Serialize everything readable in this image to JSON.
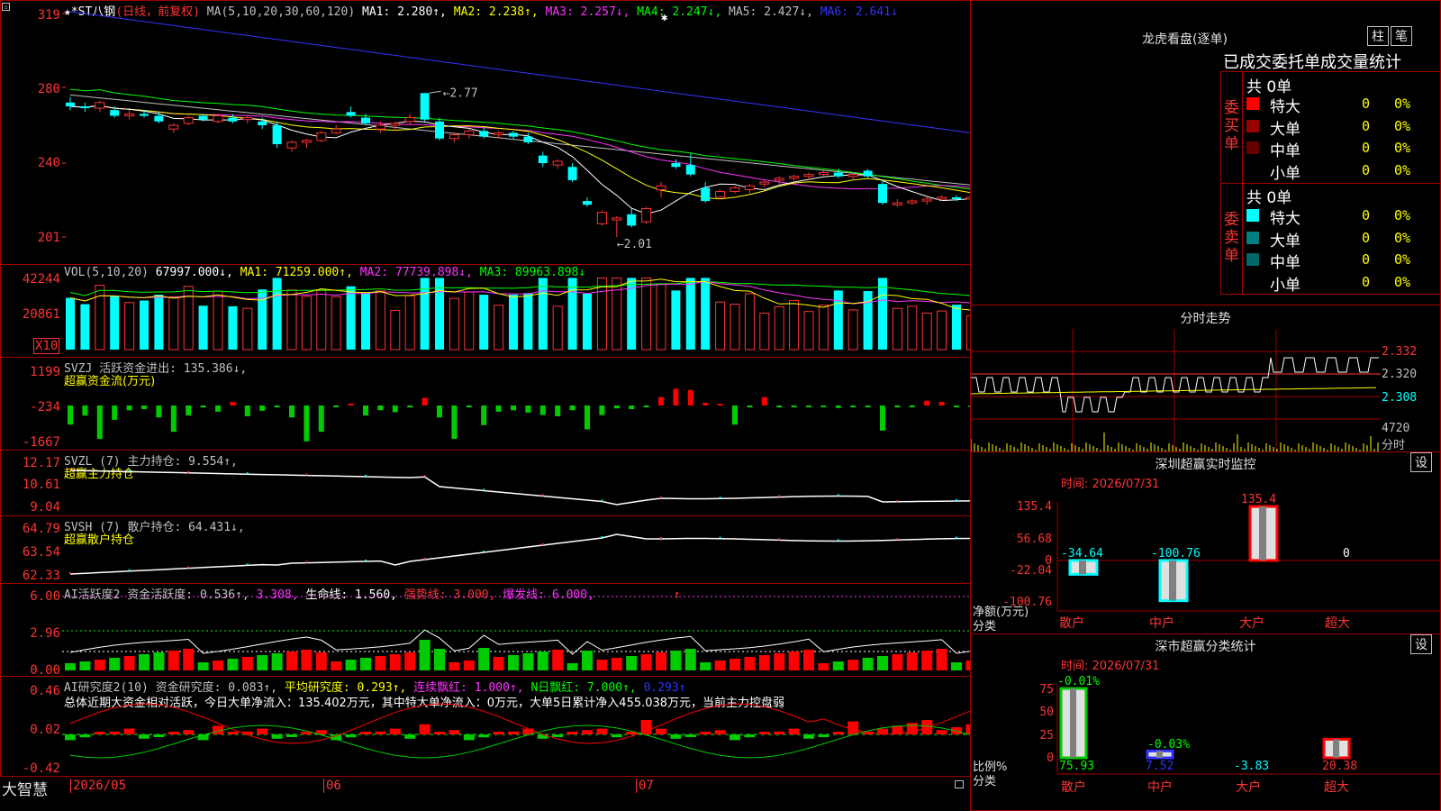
{
  "main": {
    "header": {
      "stock": "★*ST八钢",
      "mode": "(日线，前复权)",
      "ma_text": "MA(5,10,20,30,60,120)",
      "ma1": "MA1: 2.280↑,",
      "ma2": "MA2: 2.238↑,",
      "ma3": "MA3: 2.257↓,",
      "ma4": "MA4: 2.247↓,",
      "ma5": "MA5: 2.427↓,",
      "ma6": "MA6: 2.641↓"
    },
    "y_ticks": [
      "319",
      "280",
      "240",
      "201"
    ],
    "annot_high": "2.77",
    "annot_low": "2.01"
  },
  "vol": {
    "header": {
      "name": "VOL(5,10,20)",
      "v": "67997.000↓,",
      "ma1": "MA1: 71259.000↑,",
      "ma2": "MA2: 77739.898↓,",
      "ma3": "MA3: 89963.898↓"
    },
    "y_ticks": [
      "42244",
      "20861"
    ],
    "unit": "X10"
  },
  "svzj": {
    "header": {
      "name": "SVZJ  活跃资金进出: 135.386↓,",
      "sub": "超赢资金流(万元)"
    },
    "y_ticks": [
      "1199",
      "-234",
      "-1667"
    ]
  },
  "svzl": {
    "header": {
      "name": "SVZL (7) 主力持仓: 9.554↑,",
      "sub": "超赢主力持仓"
    },
    "y_ticks": [
      "12.17",
      "10.61",
      "9.04"
    ]
  },
  "svsh": {
    "header": {
      "name": "SVSH (7) 散户持仓: 64.431↓,",
      "sub": "超赢散户持仓"
    },
    "y_ticks": [
      "64.79",
      "63.54",
      "62.33"
    ]
  },
  "ai1": {
    "header": {
      "name": "AI活跃度2 资金活跃度: 0.536↑,",
      "v2": "3.308,",
      "life": "生命线: 1.560,",
      "strong": "强势线: 3.000,",
      "burst": "爆发线: 6.000,",
      "arrow": "↑"
    },
    "y_ticks": [
      "6.00",
      "2.96",
      "0.00"
    ]
  },
  "ai2": {
    "header": {
      "name": "AI研究度2(10) 资金研究度: 0.083↑,",
      "avg": "平均研究度: 0.293↑,",
      "cont": "连续飘红: 1.000↑,",
      "nday": "N日飘红: 7.000↑,",
      "last": "0.293↑"
    },
    "summary": "总体近期大资金相对活跃，今日大单净流入：135.402万元，其中特大单净流入：0万元，大单5日累计净入455.038万元，当前主力控盘弱",
    "y_ticks": [
      "0.46",
      "0.02",
      "-0.42"
    ]
  },
  "bottom": {
    "brand": "大智慧",
    "dates": [
      "2026/05",
      "06",
      "07"
    ]
  },
  "longhu": {
    "title": "龙虎看盘(逐单)",
    "btn_zhu": "柱",
    "btn_bi": "笔",
    "subtitle": "已成交委托单成交量统计",
    "buy_label": "委买单",
    "sell_label": "委卖单",
    "buy_total": "共 0单",
    "sell_total": "共 0单",
    "buy_rows": [
      {
        "label": "特大",
        "count": "0",
        "pct": "0%",
        "color": "#ff0000"
      },
      {
        "label": "大单",
        "count": "0",
        "pct": "0%",
        "color": "#990000"
      },
      {
        "label": "中单",
        "count": "0",
        "pct": "0%",
        "color": "#660000"
      },
      {
        "label": "小单",
        "count": "0",
        "pct": "0%",
        "color": "#000000"
      }
    ],
    "sell_rows": [
      {
        "label": "特大",
        "count": "0",
        "pct": "0%",
        "color": "#00ffff"
      },
      {
        "label": "大单",
        "count": "0",
        "pct": "0%",
        "color": "#008080"
      },
      {
        "label": "中单",
        "count": "0",
        "pct": "0%",
        "color": "#006666"
      },
      {
        "label": "小单",
        "count": "0",
        "pct": "0%",
        "color": "#000000"
      }
    ]
  },
  "fenshi": {
    "title": "分时走势",
    "y_ticks": [
      "2.332",
      "2.320",
      "2.308"
    ],
    "vol_tick": "4720",
    "vol_unit": "分时"
  },
  "sz_monitor": {
    "title": "深圳超赢实时监控",
    "btn": "设",
    "time": "时间: 2026/07/31",
    "y_ticks": [
      "135.4",
      "56.68",
      "0",
      "-22.04",
      "-100.76"
    ],
    "ylabel1": "净额(万元)",
    "ylabel2": "分类",
    "categories": [
      "散户",
      "中户",
      "大户",
      "超大"
    ],
    "values": [
      "-34.64",
      "-100.76",
      "135.4",
      "0"
    ]
  },
  "sz_stats": {
    "title": "深市超赢分类统计",
    "btn": "设",
    "time": "时间: 2026/07/31",
    "y_ticks": [
      "75",
      "50",
      "25",
      "0"
    ],
    "ylabel1": "比例%",
    "ylabel2": "分类",
    "categories": [
      "散户",
      "中户",
      "大户",
      "超大"
    ],
    "top_labels": [
      "-0.01%",
      "-0.03%"
    ],
    "values": [
      "75.93",
      "7.52",
      "-3.83",
      "20.38"
    ]
  },
  "chart_data": {
    "type": "line",
    "title": "",
    "candles": [
      [
        2.72,
        2.75,
        2.68,
        2.7
      ],
      [
        2.7,
        2.72,
        2.67,
        2.69
      ],
      [
        2.69,
        2.73,
        2.67,
        2.72
      ],
      [
        2.68,
        2.7,
        2.64,
        2.65
      ],
      [
        2.65,
        2.68,
        2.63,
        2.66
      ],
      [
        2.66,
        2.68,
        2.64,
        2.65
      ],
      [
        2.65,
        2.67,
        2.61,
        2.62
      ],
      [
        2.58,
        2.61,
        2.56,
        2.6
      ],
      [
        2.61,
        2.65,
        2.6,
        2.64
      ],
      [
        2.65,
        2.66,
        2.62,
        2.63
      ],
      [
        2.62,
        2.66,
        2.61,
        2.65
      ],
      [
        2.64,
        2.66,
        2.61,
        2.62
      ],
      [
        2.63,
        2.65,
        2.61,
        2.64
      ],
      [
        2.62,
        2.64,
        2.58,
        2.6
      ],
      [
        2.6,
        2.62,
        2.48,
        2.5
      ],
      [
        2.48,
        2.52,
        2.46,
        2.51
      ],
      [
        2.51,
        2.53,
        2.48,
        2.52
      ],
      [
        2.52,
        2.57,
        2.51,
        2.56
      ],
      [
        2.56,
        2.6,
        2.55,
        2.58
      ],
      [
        2.67,
        2.7,
        2.64,
        2.65
      ],
      [
        2.64,
        2.66,
        2.6,
        2.61
      ],
      [
        2.58,
        2.62,
        2.56,
        2.6
      ],
      [
        2.6,
        2.62,
        2.57,
        2.61
      ],
      [
        2.62,
        2.66,
        2.6,
        2.64
      ],
      [
        2.77,
        2.77,
        2.62,
        2.63
      ],
      [
        2.62,
        2.64,
        2.52,
        2.53
      ],
      [
        2.53,
        2.56,
        2.51,
        2.55
      ],
      [
        2.55,
        2.58,
        2.53,
        2.57
      ],
      [
        2.57,
        2.59,
        2.53,
        2.54
      ],
      [
        2.55,
        2.57,
        2.53,
        2.56
      ],
      [
        2.56,
        2.57,
        2.53,
        2.54
      ],
      [
        2.54,
        2.56,
        2.5,
        2.51
      ],
      [
        2.44,
        2.46,
        2.38,
        2.4
      ],
      [
        2.39,
        2.42,
        2.37,
        2.41
      ],
      [
        2.38,
        2.4,
        2.3,
        2.31
      ],
      [
        2.2,
        2.22,
        2.17,
        2.18
      ],
      [
        2.08,
        2.15,
        2.07,
        2.14
      ],
      [
        2.1,
        2.12,
        2.01,
        2.11
      ],
      [
        2.13,
        2.16,
        2.06,
        2.07
      ],
      [
        2.09,
        2.17,
        2.08,
        2.16
      ],
      [
        2.26,
        2.3,
        2.22,
        2.28
      ],
      [
        2.4,
        2.42,
        2.37,
        2.38
      ],
      [
        2.39,
        2.45,
        2.33,
        2.34
      ],
      [
        2.27,
        2.3,
        2.19,
        2.2
      ],
      [
        2.22,
        2.26,
        2.21,
        2.25
      ],
      [
        2.25,
        2.28,
        2.24,
        2.27
      ],
      [
        2.26,
        2.29,
        2.24,
        2.28
      ],
      [
        2.29,
        2.31,
        2.27,
        2.3
      ],
      [
        2.31,
        2.33,
        2.29,
        2.32
      ],
      [
        2.32,
        2.34,
        2.3,
        2.33
      ],
      [
        2.33,
        2.35,
        2.31,
        2.34
      ],
      [
        2.34,
        2.36,
        2.32,
        2.35
      ],
      [
        2.35,
        2.37,
        2.32,
        2.33
      ],
      [
        2.33,
        2.35,
        2.31,
        2.34
      ],
      [
        2.36,
        2.37,
        2.32,
        2.33
      ],
      [
        2.29,
        2.31,
        2.18,
        2.19
      ],
      [
        2.18,
        2.21,
        2.17,
        2.19
      ],
      [
        2.19,
        2.21,
        2.18,
        2.2
      ],
      [
        2.2,
        2.22,
        2.18,
        2.21
      ],
      [
        2.21,
        2.23,
        2.2,
        2.22
      ],
      [
        2.22,
        2.23,
        2.2,
        2.21
      ],
      [
        2.21,
        2.23,
        2.2,
        2.22
      ],
      [
        2.22,
        2.24,
        2.21,
        2.23
      ],
      [
        2.23,
        2.25,
        2.22,
        2.24
      ],
      [
        2.24,
        2.27,
        2.23,
        2.26
      ],
      [
        2.26,
        2.29,
        2.25,
        2.28
      ],
      [
        2.28,
        2.3,
        2.26,
        2.29
      ],
      [
        2.27,
        2.29,
        2.25,
        2.28
      ],
      [
        2.28,
        2.31,
        2.26,
        2.28
      ]
    ],
    "ylim": [
      2.01,
      3.19
    ],
    "dates": [
      "2026/05",
      "06",
      "07"
    ]
  }
}
